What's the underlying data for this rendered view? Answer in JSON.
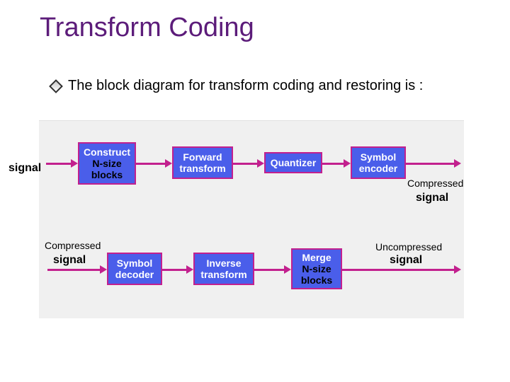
{
  "title": "Transform Coding",
  "bullet": "The block diagram for transform coding and restoring is :",
  "labels": {
    "signal_in_top": "signal",
    "compressed_top": "Compressed",
    "signal_top_right": "signal",
    "compressed_bottom": "Compressed",
    "signal_bottom_left": "signal",
    "uncompressed": "Uncompressed",
    "signal_bottom_right": "signal"
  },
  "boxes": {
    "construct_l1": "Construct",
    "construct_l2": "N-size",
    "construct_l3": "blocks",
    "forward_l1": "Forward",
    "forward_l2": "transform",
    "quantizer": "Quantizer",
    "encoder_l1": "Symbol",
    "encoder_l2": "encoder",
    "decoder_l1": "Symbol",
    "decoder_l2": "decoder",
    "inverse_l1": "Inverse",
    "inverse_l2": "transform",
    "merge_l1": "Merge",
    "merge_l2": "N-size",
    "merge_l3": "blocks"
  }
}
